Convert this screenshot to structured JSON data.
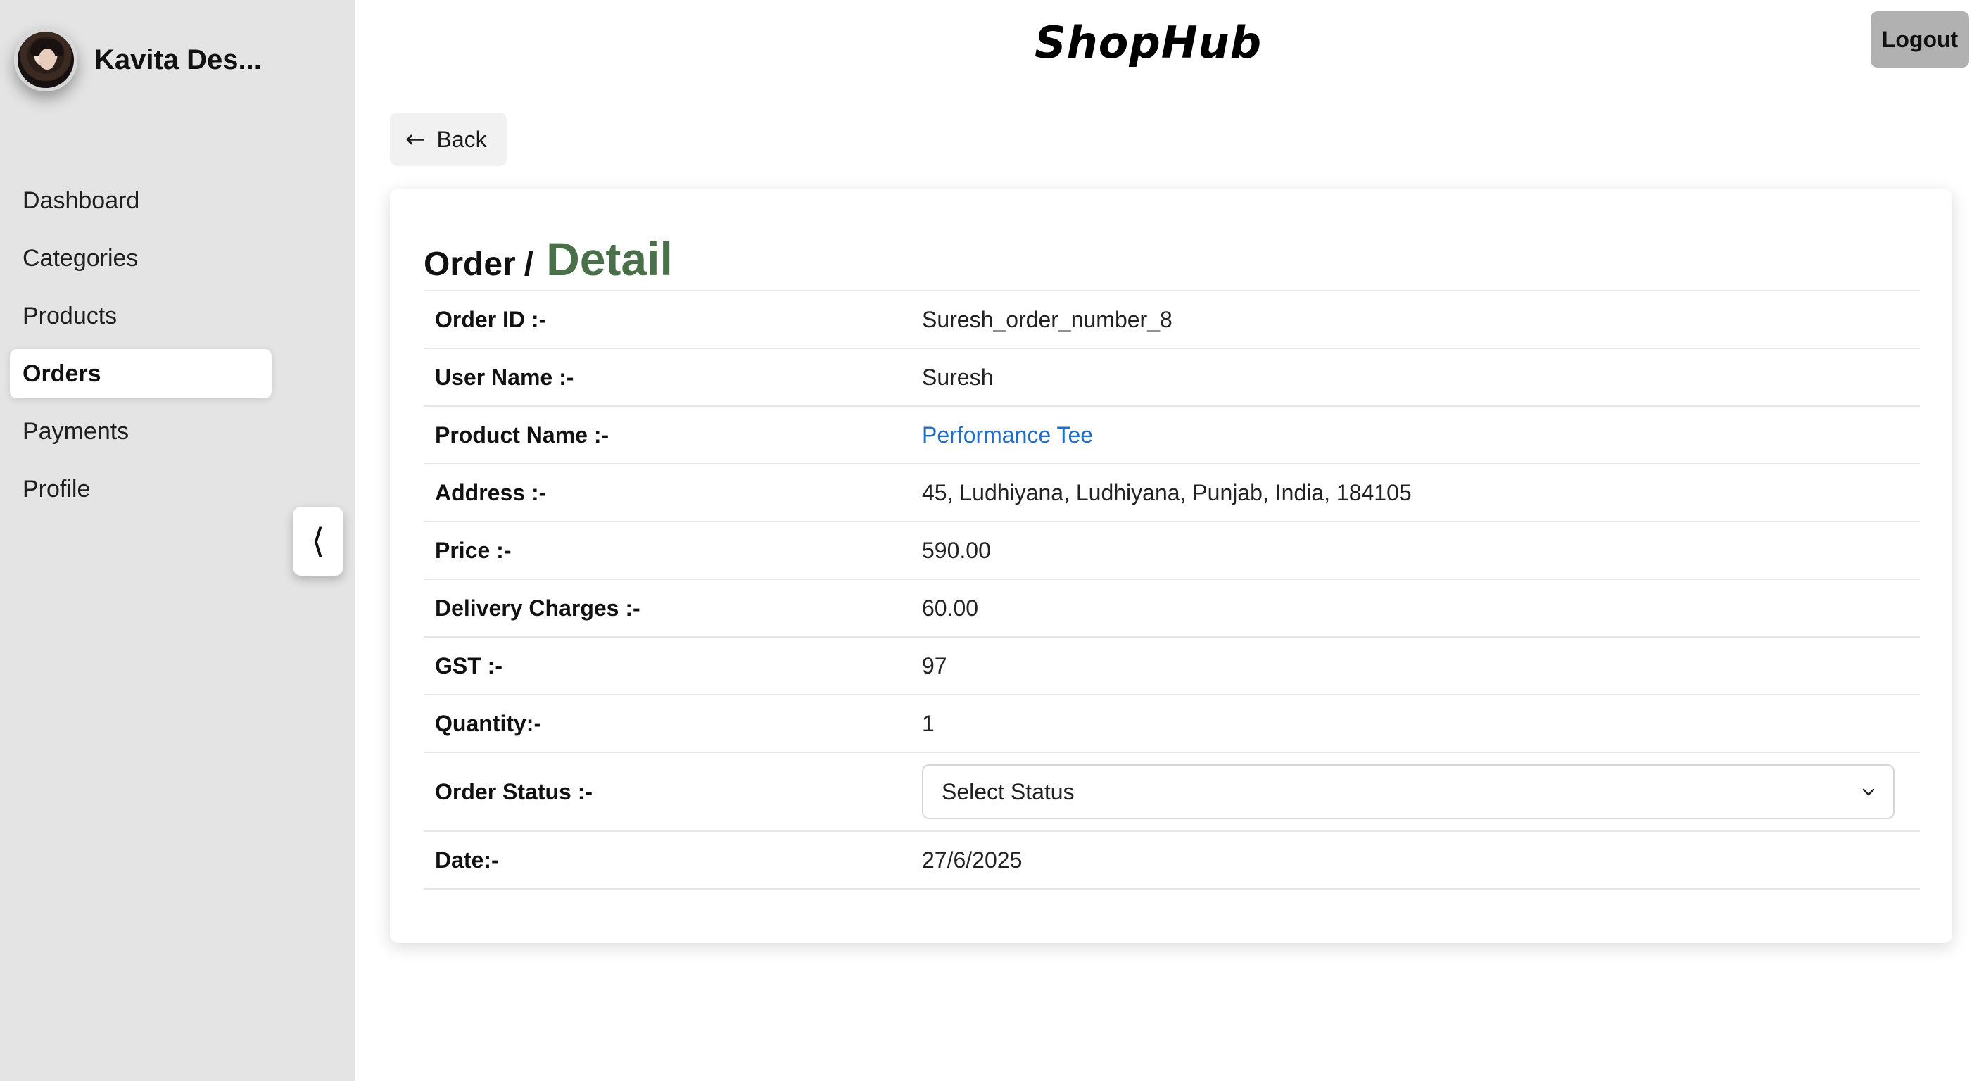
{
  "app": {
    "brand": "ShopHub",
    "logout_label": "Logout"
  },
  "user": {
    "name": "Kavita Des..."
  },
  "sidebar": {
    "items": [
      {
        "label": "Dashboard",
        "active": false
      },
      {
        "label": "Categories",
        "active": false
      },
      {
        "label": "Products",
        "active": false
      },
      {
        "label": "Orders",
        "active": true
      },
      {
        "label": "Payments",
        "active": false
      },
      {
        "label": "Profile",
        "active": false
      }
    ],
    "collapse_icon": "chevron-left-icon"
  },
  "back": {
    "label": "Back",
    "icon": "arrow-left-icon"
  },
  "detail": {
    "title_prefix": "Order",
    "title_separator": "/",
    "title_suffix": "Detail",
    "rows": [
      {
        "label": "Order ID :-",
        "value": "Suresh_order_number_8"
      },
      {
        "label": "User Name :-",
        "value": "Suresh"
      },
      {
        "label": "Product Name :-",
        "value": "Performance Tee"
      },
      {
        "label": "Address :-",
        "value": "45, Ludhiyana, Ludhiyana, Punjab, India, 184105"
      },
      {
        "label": "Price :-",
        "value": "590.00"
      },
      {
        "label": "Delivery Charges :-",
        "value": "60.00"
      },
      {
        "label": "GST :-",
        "value": "97"
      },
      {
        "label": "Quantity:-",
        "value": "1"
      },
      {
        "label": "Order Status :-",
        "value": "Select Status"
      },
      {
        "label": "Date:-",
        "value": "27/6/2025"
      }
    ]
  },
  "colors": {
    "sidebar_bg": "#e4e4e4",
    "title_accent": "#4a7049",
    "link": "#1f6fc9",
    "logout_bg": "#b1b1b1"
  }
}
